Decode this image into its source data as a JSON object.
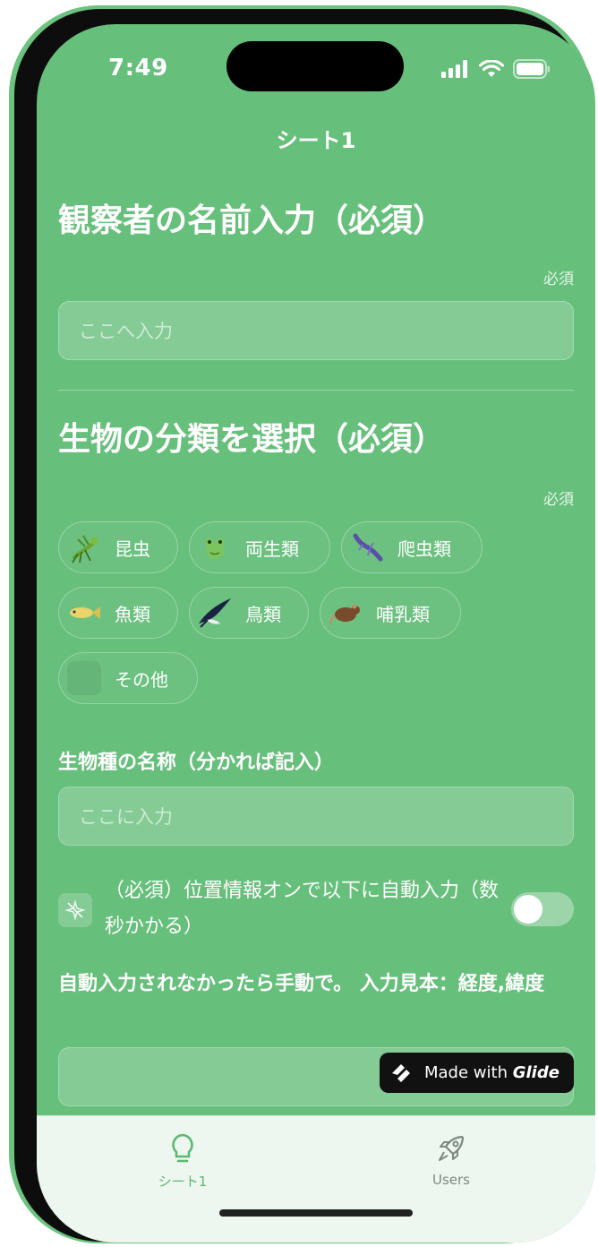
{
  "status_bar": {
    "time": "7:49"
  },
  "app": {
    "title": "シート1"
  },
  "observer_section": {
    "heading": "観察者の名前入力（必須）",
    "required_label": "必須",
    "input_placeholder": "ここへ入力"
  },
  "category_section": {
    "heading": "生物の分類を選択（必須）",
    "required_label": "必須",
    "options": [
      {
        "label": "昆虫",
        "icon": "mantis-icon"
      },
      {
        "label": "両生類",
        "icon": "frog-icon"
      },
      {
        "label": "爬虫類",
        "icon": "lizard-icon"
      },
      {
        "label": "魚類",
        "icon": "fish-icon"
      },
      {
        "label": "鳥類",
        "icon": "swallow-icon"
      },
      {
        "label": "哺乳類",
        "icon": "rat-icon"
      },
      {
        "label": "その他",
        "icon": "blank-tile-icon"
      }
    ]
  },
  "species_section": {
    "label": "生物種の名称（分かれば記入）",
    "input_placeholder": "ここに入力"
  },
  "location_toggle": {
    "label": "（必須）位置情報オンで以下に自動入力（数秒かかる）",
    "enabled": false
  },
  "coordinates_section": {
    "label": "自動入力されなかったら手動で。 入力見本：経度,緯度",
    "input_value": ""
  },
  "badge": {
    "prefix": "Made with ",
    "brand": "Glide"
  },
  "tab_bar": {
    "tabs": [
      {
        "label": "シート1",
        "icon": "lightbulb-icon",
        "active": true
      },
      {
        "label": "Users",
        "icon": "rocket-icon",
        "active": false
      }
    ]
  },
  "colors": {
    "background": "#66bf7b",
    "tab_active": "#5cb872",
    "tab_inactive": "#7a8a80"
  }
}
